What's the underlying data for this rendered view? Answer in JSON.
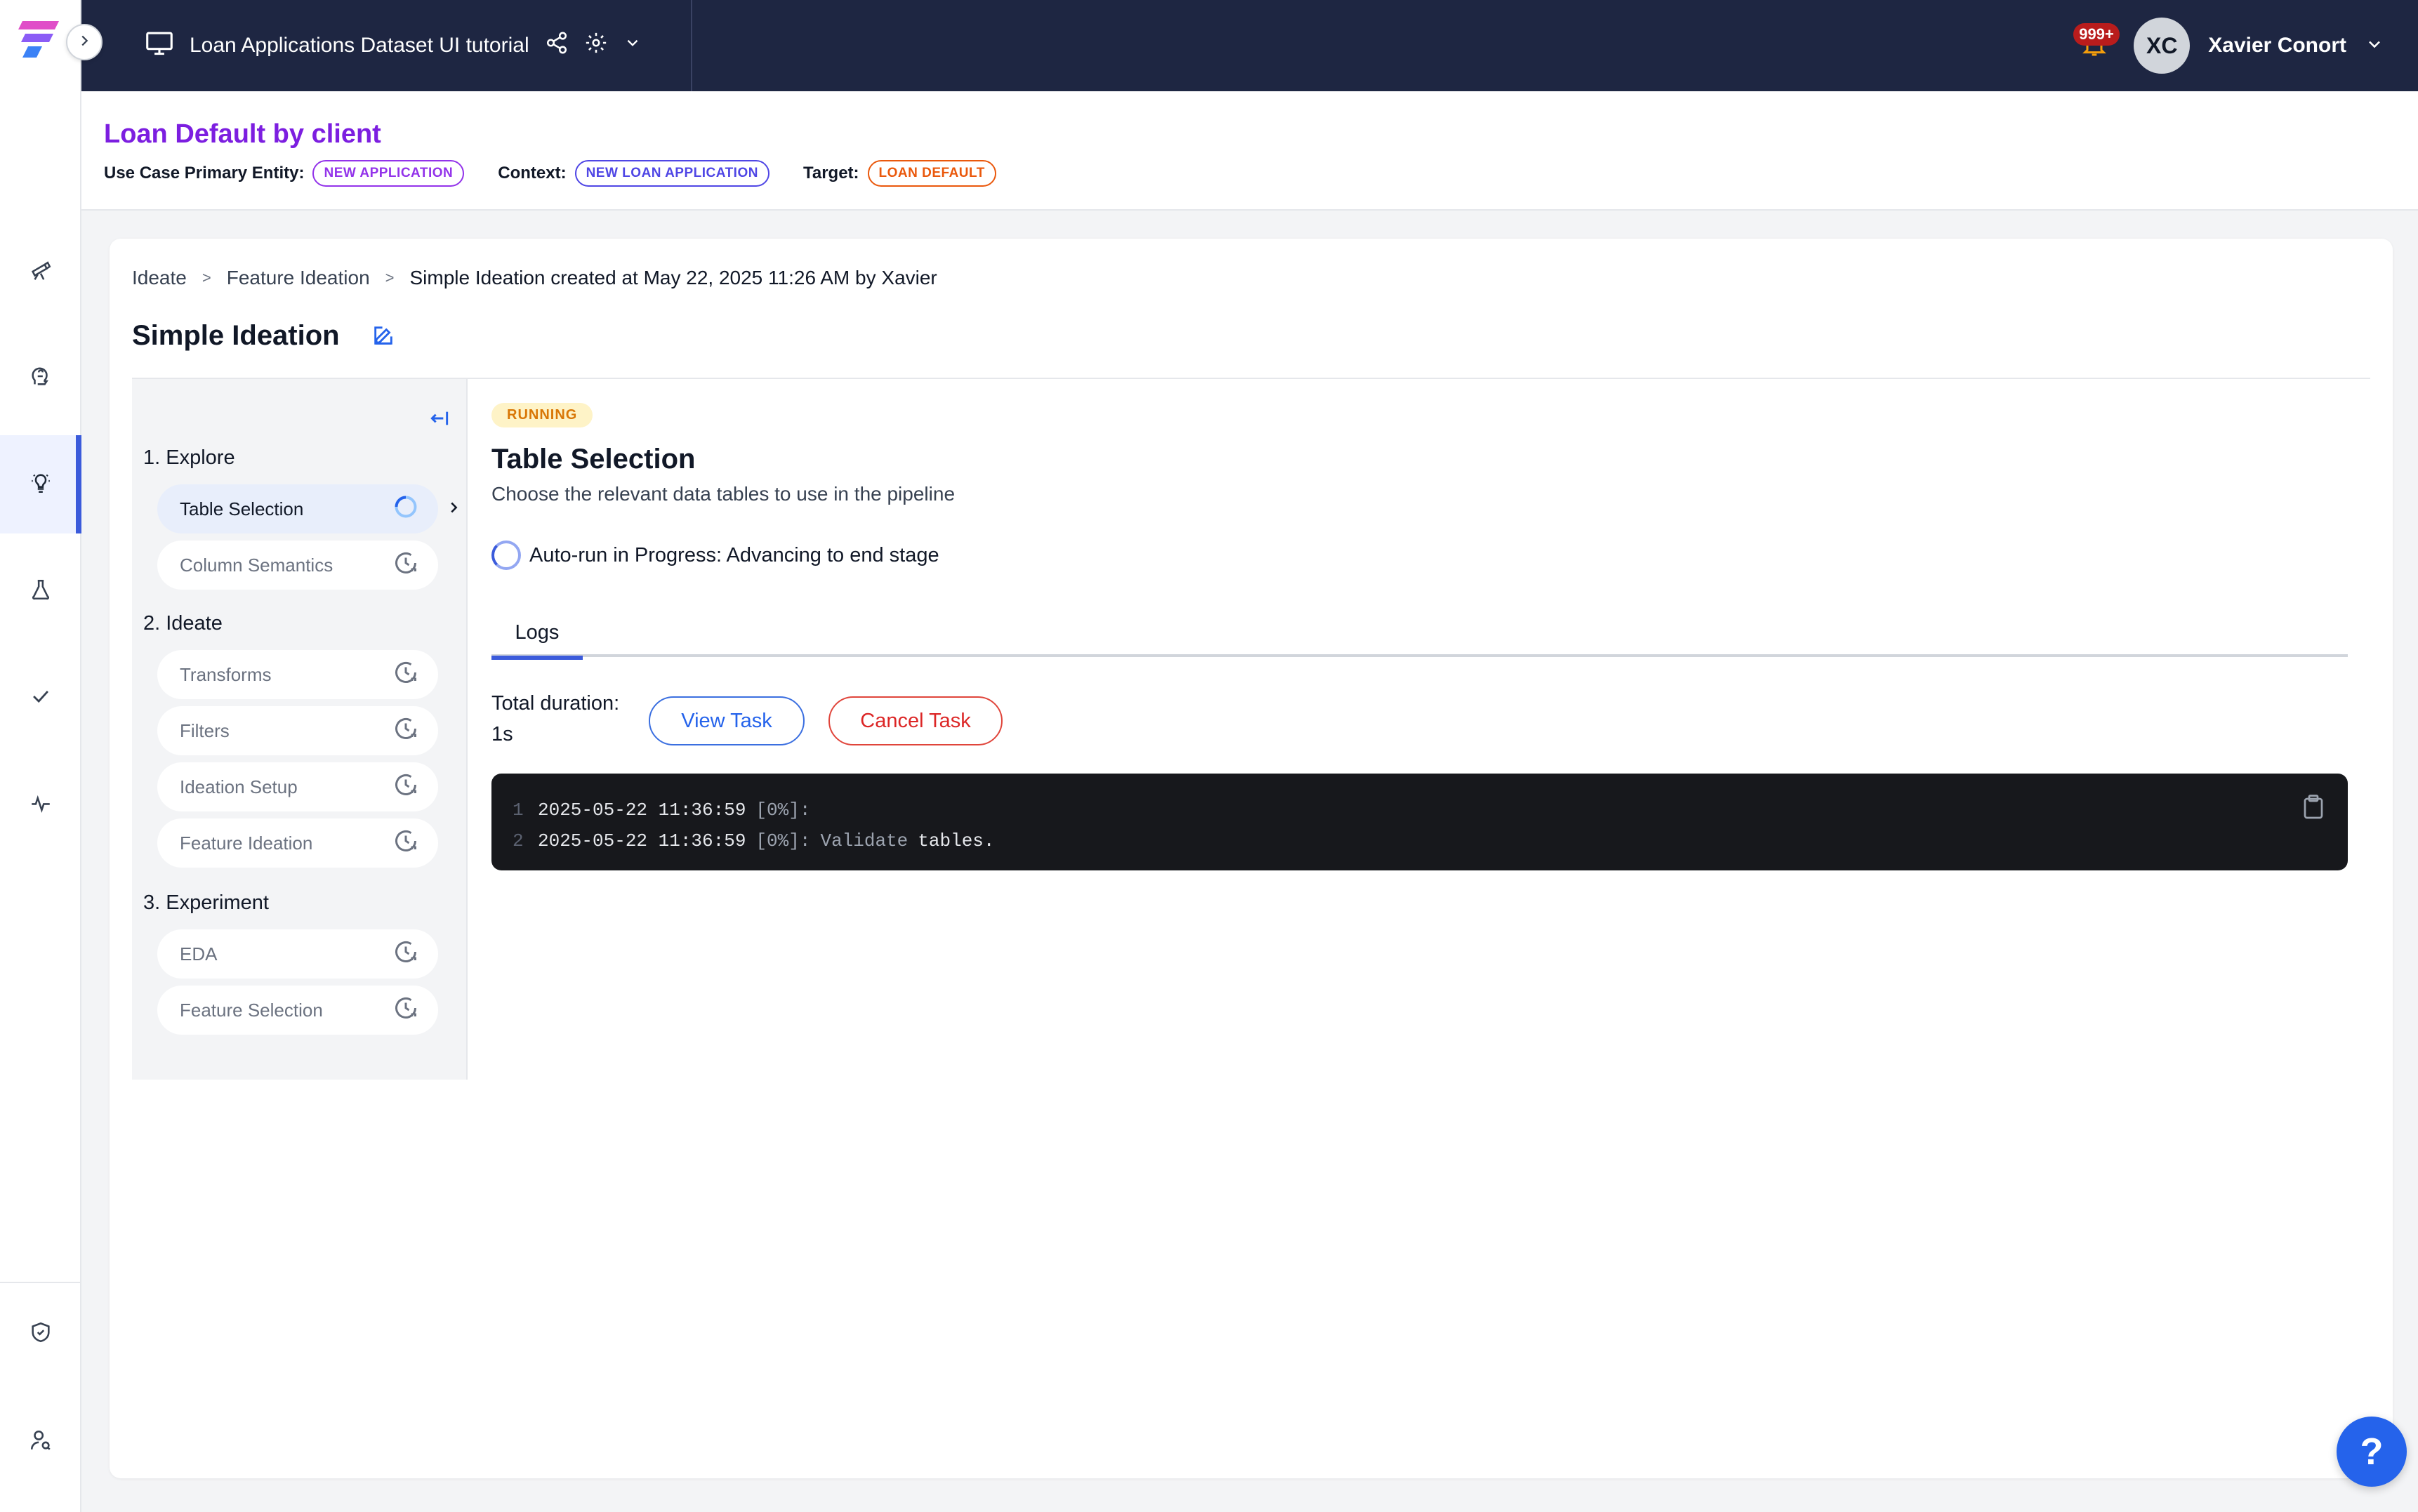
{
  "topbar": {
    "project_name": "Loan Applications Dataset UI tutorial",
    "notification_count": "999+",
    "user_initials": "XC",
    "user_name": "Xavier Conort"
  },
  "use_case": {
    "title": "Loan Default by client",
    "primary_entity_label": "Use Case Primary Entity:",
    "primary_entity_value": "NEW APPLICATION",
    "context_label": "Context:",
    "context_value": "NEW LOAN APPLICATION",
    "target_label": "Target:",
    "target_value": "LOAN DEFAULT"
  },
  "breadcrumb": {
    "items": [
      "Ideate",
      "Feature Ideation",
      "Simple Ideation created at May 22, 2025 11:26 AM by Xavier"
    ],
    "separator": ">"
  },
  "page": {
    "title": "Simple Ideation"
  },
  "stepper": {
    "groups": [
      {
        "label": "1. Explore",
        "steps": [
          "Table Selection",
          "Column Semantics"
        ]
      },
      {
        "label": "2. Ideate",
        "steps": [
          "Transforms",
          "Filters",
          "Ideation Setup",
          "Feature Ideation"
        ]
      },
      {
        "label": "3. Experiment",
        "steps": [
          "EDA",
          "Feature Selection"
        ]
      }
    ],
    "active_step": "Table Selection"
  },
  "content": {
    "status": "RUNNING",
    "title": "Table Selection",
    "subtitle": "Choose the relevant data tables to use in the pipeline",
    "autorun_text": "Auto-run in Progress: Advancing to end stage",
    "tabs": [
      "Logs"
    ],
    "duration_label": "Total duration:",
    "duration_value": "1s",
    "view_task_label": "View Task",
    "cancel_task_label": "Cancel Task",
    "logs": [
      {
        "num": "1",
        "timestamp": "2025-05-22 11:36:59",
        "pct": "[0%]:",
        "keyword": "",
        "text": ""
      },
      {
        "num": "2",
        "timestamp": "2025-05-22 11:36:59",
        "pct": "[0%]:",
        "keyword": "Validate",
        "text": "tables."
      }
    ]
  },
  "help": {
    "label": "?"
  },
  "colors": {
    "topbar_bg": "#1e2642",
    "accent": "#3b5bdb",
    "title_purple": "#7c1ee0",
    "running_bg": "#fef3c7",
    "running_fg": "#d97706",
    "cancel_red": "#dc2626"
  }
}
